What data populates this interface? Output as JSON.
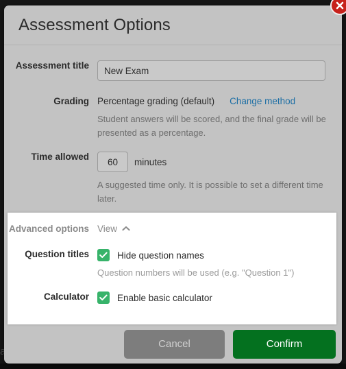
{
  "dialog": {
    "title": "Assessment Options",
    "close_icon": "close-x-icon"
  },
  "backdrop": {
    "ghost_text": "a"
  },
  "form": {
    "assessment_title": {
      "label": "Assessment title",
      "value": "New Exam",
      "placeholder": "Assessment title"
    },
    "grading": {
      "label": "Grading",
      "value": "Percentage grading (default)",
      "change_link": "Change method",
      "hint": "Student answers will be scored, and the final grade will be presented as a percentage."
    },
    "time_allowed": {
      "label": "Time allowed",
      "value": "60",
      "unit": "minutes",
      "hint": "A suggested time only. It is possible to set a different time later."
    }
  },
  "advanced_options": {
    "label": "Advanced options",
    "toggle_label": "View",
    "toggle_icon": "chevron-up-icon",
    "expanded": true,
    "question_titles": {
      "label": "Question titles",
      "checkbox_label": "Hide question names",
      "checked": true,
      "hint": "Question numbers will be used (e.g. \"Question 1\")"
    },
    "calculator": {
      "label": "Calculator",
      "checkbox_label": "Enable basic calculator",
      "checked": true
    }
  },
  "footer": {
    "cancel_label": "Cancel",
    "confirm_label": "Confirm"
  },
  "colors": {
    "accent_green": "#04711f",
    "checkbox_green": "#37b36a",
    "link_blue": "#1c6ea4",
    "close_red": "#c7211b",
    "dialog_gray": "#c3c3c3"
  }
}
